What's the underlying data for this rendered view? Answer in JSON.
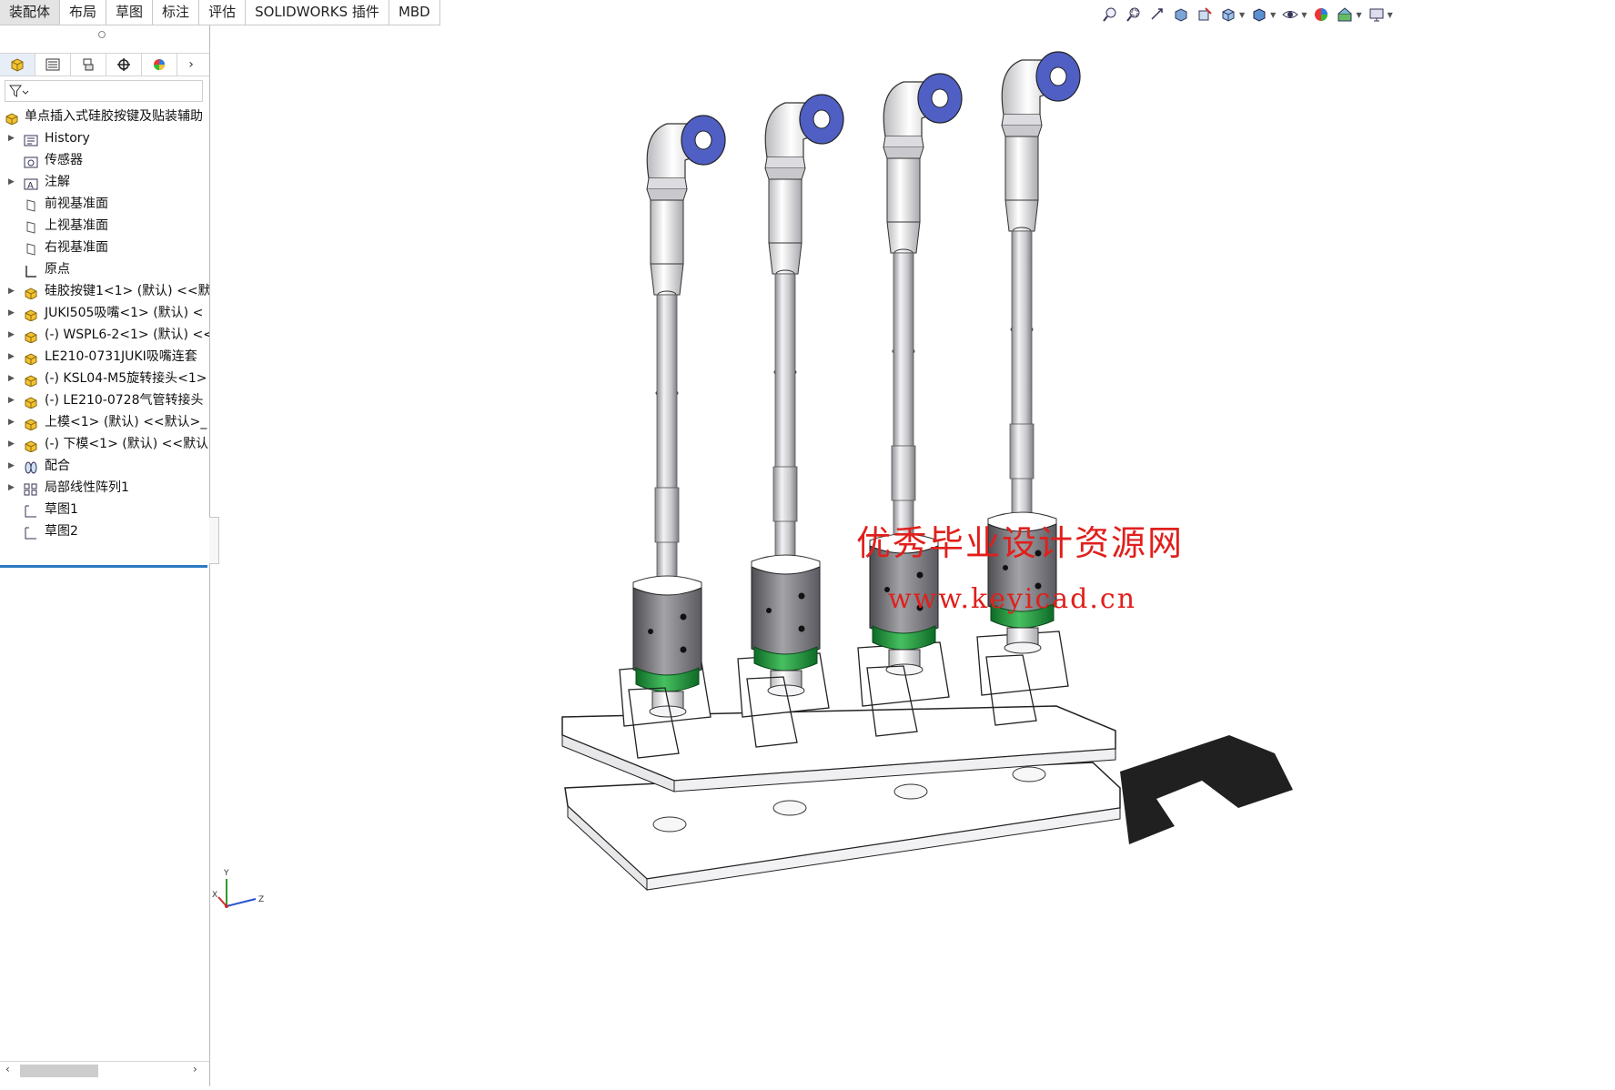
{
  "tabs": [
    "装配体",
    "布局",
    "草图",
    "标注",
    "评估",
    "SOLIDWORKS 插件",
    "MBD"
  ],
  "active_tab": "装配体",
  "panel_tabs": [
    "feature-manager-icon",
    "property-manager-icon",
    "configuration-manager-icon",
    "dimxpert-icon",
    "display-manager-icon"
  ],
  "tree": {
    "root": "单点插入式硅胶按键及贴装辅助",
    "items": [
      {
        "label": "History",
        "icon": "history-icon",
        "expandable": true
      },
      {
        "label": "传感器",
        "icon": "sensor-icon",
        "expandable": false
      },
      {
        "label": "注解",
        "icon": "annotation-icon",
        "expandable": true
      },
      {
        "label": "前视基准面",
        "icon": "plane-icon",
        "expandable": false
      },
      {
        "label": "上视基准面",
        "icon": "plane-icon",
        "expandable": false
      },
      {
        "label": "右视基准面",
        "icon": "plane-icon",
        "expandable": false
      },
      {
        "label": "原点",
        "icon": "origin-icon",
        "expandable": false
      },
      {
        "label": "硅胶按键1<1> (默认) <<默",
        "icon": "part-icon",
        "expandable": true
      },
      {
        "label": "JUKI505吸嘴<1> (默认) <",
        "icon": "part-icon",
        "expandable": true
      },
      {
        "label": "(-) WSPL6-2<1> (默认) <<",
        "icon": "part-icon",
        "expandable": true
      },
      {
        "label": "LE210-0731JUKI吸嘴连套",
        "icon": "part-icon",
        "expandable": true
      },
      {
        "label": "(-) KSL04-M5旋转接头<1>",
        "icon": "part-icon",
        "expandable": true
      },
      {
        "label": "(-) LE210-0728气管转接头",
        "icon": "part-icon",
        "expandable": true
      },
      {
        "label": "上模<1> (默认) <<默认>_",
        "icon": "part-icon",
        "expandable": true
      },
      {
        "label": "(-) 下模<1> (默认) <<默认",
        "icon": "part-icon",
        "expandable": true
      },
      {
        "label": "配合",
        "icon": "mates-icon",
        "expandable": true
      },
      {
        "label": "局部线性阵列1",
        "icon": "pattern-icon",
        "expandable": true
      },
      {
        "label": "草图1",
        "icon": "sketch-icon",
        "expandable": false
      },
      {
        "label": "草图2",
        "icon": "sketch-icon",
        "expandable": false
      }
    ]
  },
  "watermark": {
    "line1": "优秀毕业设计资源网",
    "line2": "www.keyicad.cn"
  },
  "triad": {
    "x": "X",
    "y": "Y",
    "z": "Z"
  },
  "colors": {
    "accent": "#2b79c2",
    "watermark": "#e0201c",
    "nozzle_blue": "#4f5fc4",
    "ring_green": "#1e8f3a"
  }
}
